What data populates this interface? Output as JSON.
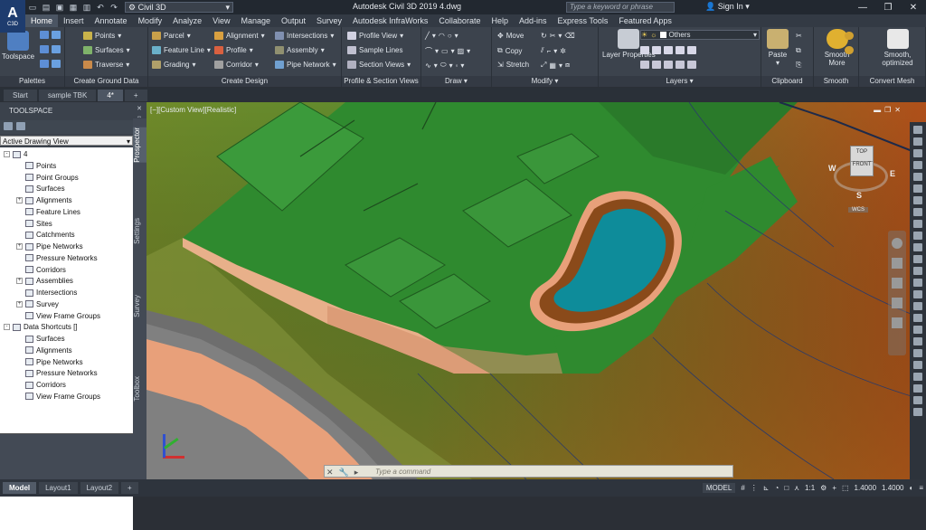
{
  "app": {
    "logo_letter": "A",
    "logo_sub": "C3D",
    "workspace": "Civil 3D",
    "title": "Autodesk Civil 3D 2019    4.dwg",
    "search_placeholder": "Type a keyword or phrase",
    "sign_in": "Sign In"
  },
  "menu_tabs": [
    "Home",
    "Insert",
    "Annotate",
    "Modify",
    "Analyze",
    "View",
    "Manage",
    "Output",
    "Survey",
    "Autodesk InfraWorks",
    "Collaborate",
    "Help",
    "Add-ins",
    "Express Tools",
    "Featured Apps"
  ],
  "ribbon": {
    "palettes": {
      "title": "Palettes",
      "toolspace": "Toolspace"
    },
    "ground": {
      "title": "Create Ground Data",
      "points": "Points",
      "surfaces": "Surfaces",
      "traverse": "Traverse"
    },
    "design": {
      "title": "Create Design",
      "parcel": "Parcel",
      "feature_line": "Feature Line",
      "grading": "Grading",
      "alignment": "Alignment",
      "profile": "Profile",
      "corridor": "Corridor",
      "intersections": "Intersections",
      "assembly": "Assembly",
      "pipe_network": "Pipe Network"
    },
    "profile_section": {
      "title": "Profile & Section Views",
      "profile_view": "Profile View",
      "sample_lines": "Sample Lines",
      "section_views": "Section Views"
    },
    "draw": {
      "title": "Draw"
    },
    "modify": {
      "title": "Modify",
      "move": "Move",
      "copy": "Copy",
      "stretch": "Stretch"
    },
    "layers": {
      "title": "Layers",
      "layer_properties": "Layer Properties",
      "layer_name": "Others"
    },
    "clipboard": {
      "title": "Clipboard",
      "paste": "Paste"
    },
    "smooth": {
      "title": "Smooth",
      "smooth_more": "Smooth More"
    },
    "convert": {
      "title": "Convert Mesh",
      "smooth_optimized": "Smooth, optimized"
    }
  },
  "file_tabs": [
    "Start",
    "sample TBK",
    "4*"
  ],
  "toolspace": {
    "header": "TOOLSPACE",
    "dropdown": "Active Drawing View",
    "vtabs": [
      "Prospector",
      "Settings",
      "Survey",
      "Toolbox"
    ]
  },
  "tree": [
    {
      "label": "4",
      "indent": 0,
      "exp": "-"
    },
    {
      "label": "Points",
      "indent": 1,
      "exp": ""
    },
    {
      "label": "Point Groups",
      "indent": 1,
      "exp": ""
    },
    {
      "label": "Surfaces",
      "indent": 1,
      "exp": ""
    },
    {
      "label": "Alignments",
      "indent": 1,
      "exp": "+"
    },
    {
      "label": "Feature Lines",
      "indent": 1,
      "exp": ""
    },
    {
      "label": "Sites",
      "indent": 1,
      "exp": ""
    },
    {
      "label": "Catchments",
      "indent": 1,
      "exp": ""
    },
    {
      "label": "Pipe Networks",
      "indent": 1,
      "exp": "+"
    },
    {
      "label": "Pressure Networks",
      "indent": 1,
      "exp": ""
    },
    {
      "label": "Corridors",
      "indent": 1,
      "exp": ""
    },
    {
      "label": "Assemblies",
      "indent": 1,
      "exp": "+"
    },
    {
      "label": "Intersections",
      "indent": 1,
      "exp": ""
    },
    {
      "label": "Survey",
      "indent": 1,
      "exp": "+"
    },
    {
      "label": "View Frame Groups",
      "indent": 1,
      "exp": ""
    },
    {
      "label": "Data Shortcuts []",
      "indent": 0,
      "exp": "-"
    },
    {
      "label": "Surfaces",
      "indent": 1,
      "exp": ""
    },
    {
      "label": "Alignments",
      "indent": 1,
      "exp": ""
    },
    {
      "label": "Pipe Networks",
      "indent": 1,
      "exp": ""
    },
    {
      "label": "Pressure Networks",
      "indent": 1,
      "exp": ""
    },
    {
      "label": "Corridors",
      "indent": 1,
      "exp": ""
    },
    {
      "label": "View Frame Groups",
      "indent": 1,
      "exp": ""
    }
  ],
  "viewport": {
    "label": "[−][Custom View][Realistic]",
    "cube_top": "TOP",
    "cube_front": "FRONT",
    "n": "N",
    "w": "W",
    "e": "E",
    "s": "S",
    "wcs": "WCS"
  },
  "command": {
    "placeholder": "Type a command"
  },
  "layout_tabs": [
    "Model",
    "Layout1",
    "Layout2"
  ],
  "status": {
    "model": "MODEL",
    "scale": "1:1",
    "val1": "1.4000",
    "val2": "1.4000"
  },
  "colors": {
    "accent": "#1e3c6e",
    "terrain": "#2e8b2e",
    "water": "#0e8c9a"
  }
}
